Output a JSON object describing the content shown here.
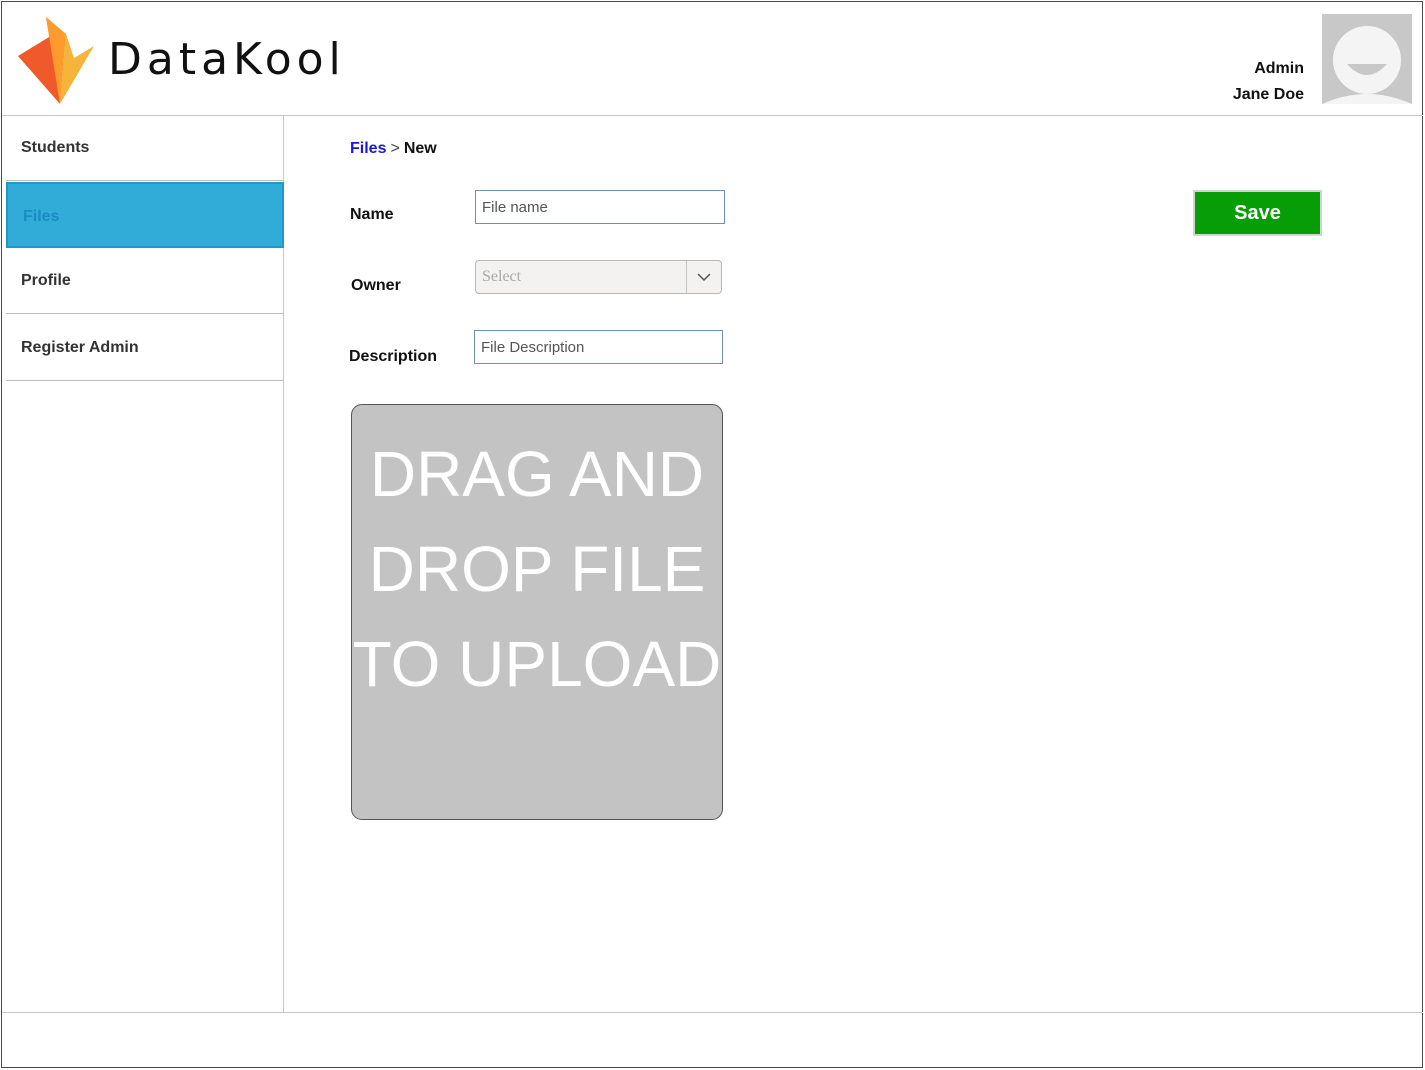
{
  "brand": {
    "name": "DataKool"
  },
  "user": {
    "role": "Admin",
    "name": "Jane Doe"
  },
  "sidebar": {
    "items": [
      {
        "label": "Students",
        "active": false
      },
      {
        "label": "Files",
        "active": true
      },
      {
        "label": "Profile",
        "active": false
      },
      {
        "label": "Register Admin",
        "active": false
      }
    ]
  },
  "breadcrumb": {
    "parent": "Files",
    "separator": ">",
    "current": "New"
  },
  "form": {
    "name": {
      "label": "Name",
      "placeholder": "File name",
      "value": ""
    },
    "owner": {
      "label": "Owner",
      "selected": "Select"
    },
    "description": {
      "label": "Description",
      "placeholder": "File Description",
      "value": ""
    },
    "save_label": "Save",
    "dropzone_text": "DRAG AND DROP FILE TO UPLOAD"
  },
  "colors": {
    "accent_active": "#31acd8",
    "save_button": "#079d07",
    "breadcrumb_link": "#1a1ad6",
    "dropzone": "#c3c3c3"
  },
  "icons": {
    "logo": "datakool-logo-icon",
    "avatar": "user-avatar-icon",
    "dropdown": "chevron-down-icon"
  }
}
